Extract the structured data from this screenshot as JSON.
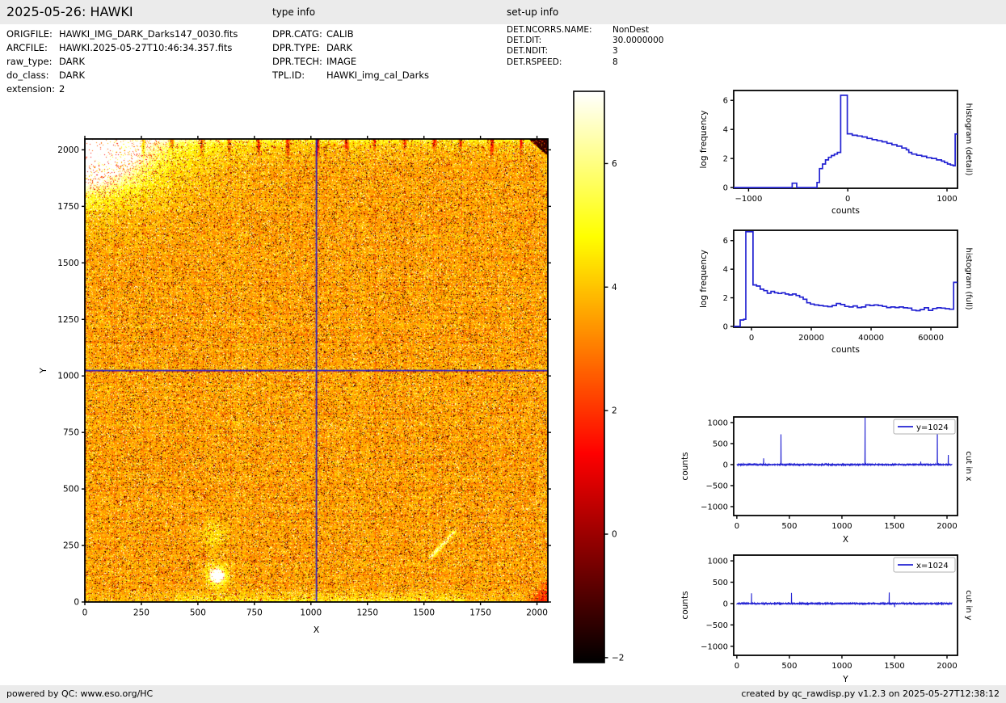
{
  "page": {
    "title": "2025-05-26: HAWKI",
    "header": {
      "type_info_label": "type info",
      "setup_info_label": "set-up info"
    },
    "footer": {
      "left": "powered by QC: www.eso.org/HC",
      "right": "created by qc_rawdisp.py v1.2.3 on 2025-05-27T12:38:12"
    },
    "colors": {
      "accent_line": "#2222d2",
      "header_bg": "#ebebeb",
      "axis": "#000000",
      "legend_border": "#b0b0b0"
    }
  },
  "metadata": {
    "file_info": {
      "rows": [
        {
          "label": "ORIGFILE:",
          "value": "HAWKI_IMG_DARK_Darks147_0030.fits"
        },
        {
          "label": "ARCFILE:",
          "value": "HAWKI.2025-05-27T10:46:34.357.fits"
        },
        {
          "label": "raw_type:",
          "value": "DARK"
        },
        {
          "label": "do_class:",
          "value": "DARK"
        },
        {
          "label": "extension:",
          "value": "2"
        }
      ]
    },
    "type_info": {
      "rows": [
        {
          "label": "DPR.CATG:",
          "value": "CALIB"
        },
        {
          "label": "DPR.TYPE:",
          "value": "DARK"
        },
        {
          "label": "DPR.TECH:",
          "value": "IMAGE"
        },
        {
          "label": "TPL.ID:",
          "value": "HAWKI_img_cal_Darks"
        }
      ]
    },
    "setup_info": {
      "rows": [
        {
          "label": "DET.NCORRS.NAME:",
          "value": "NonDest"
        },
        {
          "label": "DET.DIT:",
          "value": "30.0000000"
        },
        {
          "label": "DET.NDIT:",
          "value": "3"
        },
        {
          "label": "DET.RSPEED:",
          "value": "8"
        }
      ]
    }
  },
  "chart_data": [
    {
      "id": "main-image",
      "type": "heatmap",
      "description": "2048x2048 raw HAWKI dark frame displayed with hot colormap; mostly salt-and-pepper noise around value 3 with saturated top-left corner, dark top-right corner, dark drip artifacts along top edge, hot pixel blob and faint streak, blue cut crosshair at x=1024 y=1024",
      "xlabel": "X",
      "ylabel": "Y",
      "xlim": [
        0,
        2048
      ],
      "ylim": [
        0,
        2048
      ],
      "xticks": [
        0,
        250,
        500,
        750,
        1000,
        1250,
        1500,
        1750,
        2000
      ],
      "yticks": [
        0,
        250,
        500,
        750,
        1000,
        1250,
        1500,
        1750,
        2000
      ],
      "colormap": "hot",
      "value_range": [
        -2.08,
        7.17
      ],
      "colorbar_ticks": [
        6,
        4,
        2,
        0,
        -2
      ],
      "cut_lines": {
        "x": 1024,
        "y": 1024
      },
      "features": [
        {
          "type": "saturated_corner",
          "corner": "top-left"
        },
        {
          "type": "dark_corner",
          "corner": "top-right"
        },
        {
          "type": "dark_patch",
          "corner": "bottom-right"
        },
        {
          "type": "dark_drips",
          "edge": "top",
          "spacing": 128
        },
        {
          "type": "bright_blob",
          "x": 583,
          "y": 118
        },
        {
          "type": "diffuse_glow",
          "x": 570,
          "y": 300
        },
        {
          "type": "bright_streak",
          "x1": 1530,
          "y1": 200,
          "x2": 1630,
          "y2": 310
        },
        {
          "type": "block_grid",
          "spacing": 128
        },
        {
          "type": "quadrant_boundaries",
          "x": 1024,
          "y": 1024
        }
      ]
    },
    {
      "id": "histogram-detail",
      "type": "histogram-step",
      "side_label": "histogram (detail)",
      "xlabel": "counts",
      "ylabel": "log frequency",
      "xlim": [
        -1150,
        1106
      ],
      "ylim": [
        -0.05,
        6.68
      ],
      "xticks": [
        -1000,
        0,
        1000
      ],
      "yticks": [
        0,
        2,
        4,
        6
      ],
      "steps": [
        [
          -1150,
          0
        ],
        [
          -560,
          0.3
        ],
        [
          -515,
          0
        ],
        [
          -310,
          0.35
        ],
        [
          -285,
          1.3
        ],
        [
          -255,
          1.62
        ],
        [
          -225,
          1.9
        ],
        [
          -195,
          2.08
        ],
        [
          -165,
          2.2
        ],
        [
          -135,
          2.3
        ],
        [
          -105,
          2.42
        ],
        [
          -72,
          6.35
        ],
        [
          -5,
          3.7
        ],
        [
          45,
          3.6
        ],
        [
          95,
          3.55
        ],
        [
          145,
          3.48
        ],
        [
          195,
          3.38
        ],
        [
          245,
          3.3
        ],
        [
          295,
          3.22
        ],
        [
          345,
          3.15
        ],
        [
          395,
          3.05
        ],
        [
          445,
          2.95
        ],
        [
          495,
          2.85
        ],
        [
          545,
          2.72
        ],
        [
          590,
          2.6
        ],
        [
          615,
          2.42
        ],
        [
          645,
          2.3
        ],
        [
          695,
          2.22
        ],
        [
          745,
          2.15
        ],
        [
          795,
          2.05
        ],
        [
          845,
          2.0
        ],
        [
          895,
          1.9
        ],
        [
          945,
          1.82
        ],
        [
          975,
          1.72
        ],
        [
          1005,
          1.62
        ],
        [
          1035,
          1.55
        ],
        [
          1062,
          1.5
        ],
        [
          1082,
          3.68
        ],
        [
          1106,
          3.68
        ]
      ]
    },
    {
      "id": "histogram-full",
      "type": "histogram-step",
      "side_label": "histogram (full)",
      "xlabel": "counts",
      "ylabel": "log frequency",
      "xlim": [
        -5950,
        68900
      ],
      "ylim": [
        -0.06,
        6.72
      ],
      "xticks": [
        0,
        20000,
        40000,
        60000
      ],
      "yticks": [
        0,
        2,
        4,
        6
      ],
      "steps": [
        [
          -5950,
          0
        ],
        [
          -3800,
          0.45
        ],
        [
          -2600,
          0.5
        ],
        [
          -1900,
          6.62
        ],
        [
          500,
          2.9
        ],
        [
          1700,
          2.82
        ],
        [
          2900,
          2.6
        ],
        [
          4100,
          2.5
        ],
        [
          5300,
          2.32
        ],
        [
          6500,
          2.45
        ],
        [
          7700,
          2.35
        ],
        [
          8900,
          2.3
        ],
        [
          10100,
          2.35
        ],
        [
          11300,
          2.26
        ],
        [
          12500,
          2.2
        ],
        [
          13700,
          2.26
        ],
        [
          14900,
          2.16
        ],
        [
          16100,
          2.05
        ],
        [
          17300,
          1.9
        ],
        [
          18500,
          1.65
        ],
        [
          19700,
          1.56
        ],
        [
          21000,
          1.5
        ],
        [
          22500,
          1.46
        ],
        [
          24000,
          1.42
        ],
        [
          25500,
          1.38
        ],
        [
          27000,
          1.46
        ],
        [
          28400,
          1.6
        ],
        [
          29800,
          1.53
        ],
        [
          31200,
          1.4
        ],
        [
          32600,
          1.36
        ],
        [
          34000,
          1.43
        ],
        [
          35400,
          1.32
        ],
        [
          36800,
          1.36
        ],
        [
          38200,
          1.5
        ],
        [
          39600,
          1.46
        ],
        [
          41000,
          1.5
        ],
        [
          42400,
          1.46
        ],
        [
          43800,
          1.4
        ],
        [
          45200,
          1.32
        ],
        [
          46600,
          1.36
        ],
        [
          48000,
          1.32
        ],
        [
          49400,
          1.36
        ],
        [
          50800,
          1.3
        ],
        [
          52200,
          1.28
        ],
        [
          53600,
          1.14
        ],
        [
          55000,
          1.1
        ],
        [
          56400,
          1.18
        ],
        [
          57800,
          1.3
        ],
        [
          59200,
          1.12
        ],
        [
          60600,
          1.25
        ],
        [
          62000,
          1.3
        ],
        [
          63400,
          1.28
        ],
        [
          64800,
          1.24
        ],
        [
          66200,
          1.2
        ],
        [
          67600,
          3.08
        ],
        [
          68850,
          3.08
        ]
      ]
    },
    {
      "id": "cut-x",
      "type": "noisy-line",
      "side_label": "cut in x",
      "legend": "y=1024",
      "xlabel": "X",
      "ylabel": "counts",
      "xlim": [
        -30,
        2100
      ],
      "ylim": [
        -1212,
        1134
      ],
      "xticks": [
        0,
        500,
        1000,
        1500,
        2000
      ],
      "yticks": [
        1000,
        500,
        0,
        -500,
        -1000
      ],
      "n_points": 2048,
      "noise_amplitude": 12,
      "spikes": [
        [
          255,
          150
        ],
        [
          420,
          720
        ],
        [
          1220,
          1260
        ],
        [
          1750,
          70
        ],
        [
          1908,
          1060
        ],
        [
          2012,
          230
        ]
      ]
    },
    {
      "id": "cut-y",
      "type": "noisy-line",
      "side_label": "cut in y",
      "legend": "x=1024",
      "xlabel": "Y",
      "ylabel": "counts",
      "xlim": [
        -30,
        2100
      ],
      "ylim": [
        -1212,
        1134
      ],
      "xticks": [
        0,
        500,
        1000,
        1500,
        2000
      ],
      "yticks": [
        1000,
        500,
        0,
        -500,
        -1000
      ],
      "n_points": 2048,
      "noise_amplitude": 11,
      "spikes": [
        [
          140,
          240
        ],
        [
          520,
          250
        ],
        [
          1450,
          260
        ],
        [
          1502,
          -85
        ]
      ]
    }
  ]
}
